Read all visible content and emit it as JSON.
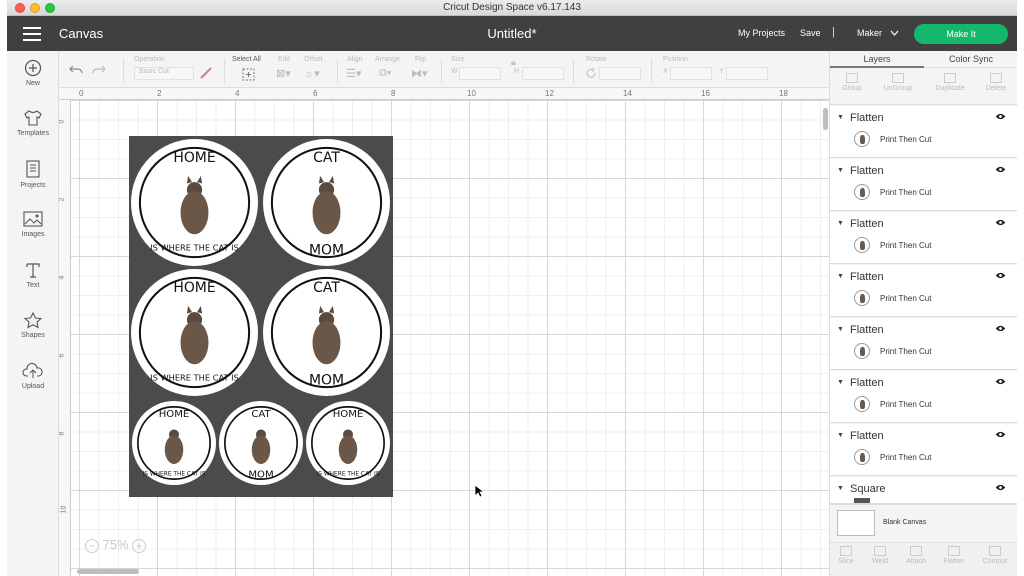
{
  "window": {
    "title": "Cricut Design Space  v6.17.143"
  },
  "header": {
    "app_name": "Canvas",
    "doc_title": "Untitled*",
    "my_projects": "My Projects",
    "save": "Save",
    "separator": "|",
    "machine": "Maker",
    "make_it": "Make It"
  },
  "leftbar": [
    {
      "label": "New",
      "icon": "plus-circle-icon"
    },
    {
      "label": "Templates",
      "icon": "shirt-icon"
    },
    {
      "label": "Projects",
      "icon": "projects-icon"
    },
    {
      "label": "Images",
      "icon": "image-icon"
    },
    {
      "label": "Text",
      "icon": "text-icon"
    },
    {
      "label": "Shapes",
      "icon": "shapes-icon"
    },
    {
      "label": "Upload",
      "icon": "upload-cloud-icon"
    }
  ],
  "toolbar": {
    "operation_label": "Operation",
    "operation_value": "Basic Cut",
    "select_all": "Select All",
    "edit": "Edit",
    "offset": "Offset",
    "align": "Align",
    "arrange": "Arrange",
    "flip": "Flip",
    "size": "Size",
    "w": "W",
    "h": "H",
    "rotate": "Rotate",
    "position": "Position",
    "x": "X",
    "y": "Y"
  },
  "canvas": {
    "ruler_top": [
      "0",
      "2",
      "4",
      "6",
      "8",
      "10",
      "12",
      "14",
      "16",
      "18"
    ],
    "ruler_left": [
      "0",
      "2",
      "4",
      "6",
      "8",
      "10"
    ],
    "zoom": "75%",
    "stickers": [
      {
        "top": "HOME",
        "bottom": "IS WHERE THE CAT IS"
      },
      {
        "top": "CAT",
        "bottom": "MOM"
      },
      {
        "top": "HOME",
        "bottom": "IS WHERE THE CAT IS"
      },
      {
        "top": "CAT",
        "bottom": "MOM"
      },
      {
        "top": "HOME",
        "bottom": "IS WHERE THE CAT IS"
      },
      {
        "top": "CAT",
        "bottom": "MOM"
      },
      {
        "top": "HOME",
        "bottom": "IS WHERE THE CAT IS"
      }
    ]
  },
  "panel": {
    "tab_layers": "Layers",
    "tab_color_sync": "Color Sync",
    "tools": [
      "Group",
      "UnGroup",
      "Duplicate",
      "Delete"
    ],
    "layers": [
      {
        "name": "Flatten",
        "sub": "Print Then Cut"
      },
      {
        "name": "Flatten",
        "sub": "Print Then Cut"
      },
      {
        "name": "Flatten",
        "sub": "Print Then Cut"
      },
      {
        "name": "Flatten",
        "sub": "Print Then Cut"
      },
      {
        "name": "Flatten",
        "sub": "Print Then Cut"
      },
      {
        "name": "Flatten",
        "sub": "Print Then Cut"
      },
      {
        "name": "Flatten",
        "sub": "Print Then Cut"
      },
      {
        "name": "Square",
        "sub": ""
      }
    ],
    "blank_canvas": "Blank Canvas",
    "footer_tools": [
      "Slice",
      "Weld",
      "Attach",
      "Flatten",
      "Contour"
    ]
  },
  "colors": {
    "header": "#404040",
    "make_it": "#14b86a",
    "board": "#4b4b4b"
  }
}
